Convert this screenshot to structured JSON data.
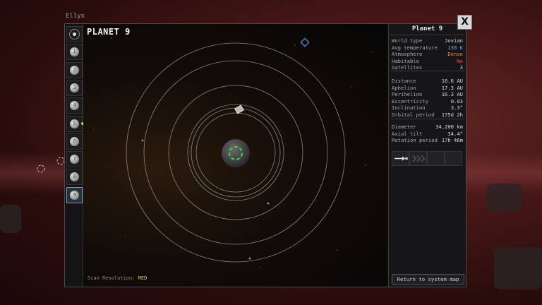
{
  "window": {
    "title": "Ellyx",
    "close_label": "X"
  },
  "sidebar": {
    "items": [
      {
        "label": "",
        "kind": "star"
      },
      {
        "label": "1"
      },
      {
        "label": "2"
      },
      {
        "label": "3"
      },
      {
        "label": "4"
      },
      {
        "label": "5"
      },
      {
        "label": "6"
      },
      {
        "label": "7"
      },
      {
        "label": "8"
      },
      {
        "label": "9",
        "selected": true
      }
    ]
  },
  "map": {
    "title": "PLANET 9",
    "scan_resolution_label": "Scan Resolution:",
    "scan_resolution_value": "MED"
  },
  "panel": {
    "title": "Planet 9",
    "group1": [
      {
        "key": "World type",
        "value": "Jovian",
        "color": "#d8d8d8"
      },
      {
        "key": "Avg temperature",
        "value": "138 K",
        "color": "#6fa8dc"
      },
      {
        "key": "Atmosphere",
        "value": "Dense",
        "color": "#e08a3a"
      },
      {
        "key": "Habitable",
        "value": "No",
        "color": "#e05050"
      },
      {
        "key": "Satellites",
        "value": "3",
        "color": "#d8d8d8"
      }
    ],
    "group2": [
      {
        "key": "Distance",
        "value": "16.6 AU"
      },
      {
        "key": "Aphelion",
        "value": "17.3 AU"
      },
      {
        "key": "Perihelion",
        "value": "16.3 AU"
      },
      {
        "key": "Eccentricity",
        "value": "0.03"
      },
      {
        "key": "Inclination",
        "value": "3.3°"
      },
      {
        "key": "Orbital period",
        "value": "175d 2h"
      }
    ],
    "group3": [
      {
        "key": "Diameter",
        "value": "34,200 km"
      },
      {
        "key": "Axial tilt",
        "value": "34.4°"
      },
      {
        "key": "Rotation period",
        "value": "17h 46m"
      }
    ],
    "return_label": "Return to system map"
  },
  "colors": {
    "accent_green": "#3ccf3c",
    "selection_blue": "#7b96b0"
  }
}
